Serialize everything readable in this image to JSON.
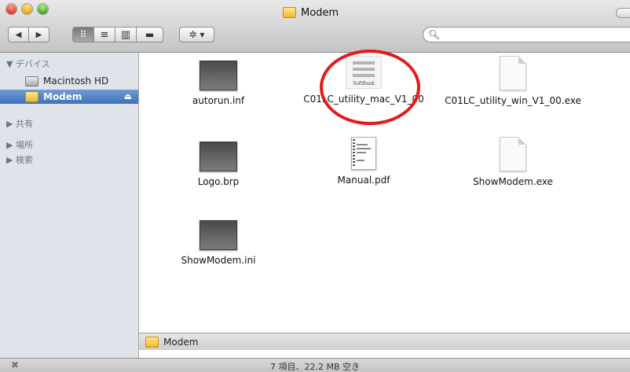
{
  "window": {
    "title": "Modem"
  },
  "toolbar": {
    "back_glyph": "◀",
    "forward_glyph": "▶",
    "views": [
      "⠿",
      "≡",
      "▥",
      "▬"
    ],
    "action_glyph": "✲ ▾",
    "search": {
      "value": "",
      "placeholder": ""
    }
  },
  "sidebar": {
    "sections": [
      {
        "label": "▼ デバイス"
      },
      {
        "label": "▶ 共有"
      },
      {
        "label": "▶ 場所"
      },
      {
        "label": "▶ 検索"
      }
    ],
    "devices": [
      {
        "label": "Macintosh HD"
      },
      {
        "label": "Modem",
        "selected": true,
        "eject_glyph": "⏏"
      }
    ]
  },
  "files": [
    {
      "name": "autorun.inf",
      "icon": "dark-thumbnail-icon"
    },
    {
      "name": "C01LC_utility_mac_V1_00",
      "icon": "softbank-app-icon",
      "thumb_text": "SoftBank"
    },
    {
      "name": "C01LC_utility_win_V1_00.exe",
      "icon": "blank-document-icon"
    },
    {
      "name": "Logo.brp",
      "icon": "dark-thumbnail-icon"
    },
    {
      "name": "Manual.pdf",
      "icon": "pdf-document-icon"
    },
    {
      "name": "ShowModem.exe",
      "icon": "blank-document-icon"
    },
    {
      "name": "ShowModem.ini",
      "icon": "dark-thumbnail-icon"
    }
  ],
  "annotation": {
    "color": "#e31a1a"
  },
  "pathbar": {
    "label": "Modem"
  },
  "status": {
    "text": "7 項目、22.2 MB 空き"
  },
  "colors": {
    "selection": "#3f72bd",
    "folder": "#f2b92a"
  }
}
